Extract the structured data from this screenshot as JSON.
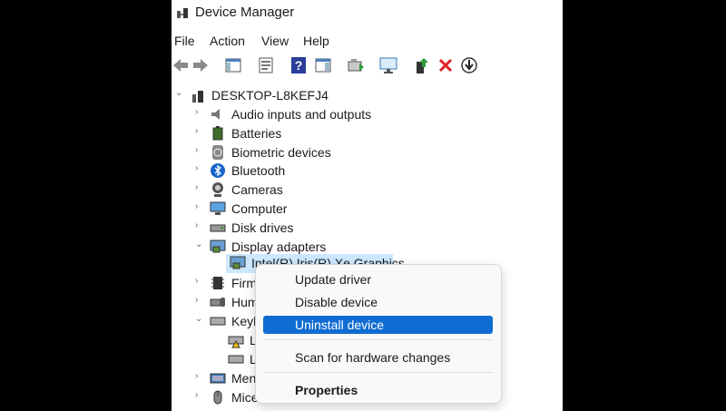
{
  "window": {
    "title": "Device Manager"
  },
  "menu": [
    "File",
    "Action",
    "View",
    "Help"
  ],
  "toolbar": {
    "icons": [
      "back-arrow-icon",
      "forward-arrow-icon",
      "show-hide-console-tree-icon",
      "properties-icon",
      "help-icon",
      "action-pane-icon",
      "update-driver-icon",
      "scan-hardware-icon",
      "enable-device-icon",
      "uninstall-device-icon",
      "disable-device-icon"
    ]
  },
  "tree": {
    "root": "DESKTOP-L8KEFJ4",
    "categories": [
      {
        "label": "Audio inputs and outputs",
        "icon": "speaker-icon"
      },
      {
        "label": "Batteries",
        "icon": "battery-icon"
      },
      {
        "label": "Biometric devices",
        "icon": "fingerprint-icon"
      },
      {
        "label": "Bluetooth",
        "icon": "bluetooth-icon"
      },
      {
        "label": "Cameras",
        "icon": "camera-icon"
      },
      {
        "label": "Computer",
        "icon": "computer-icon"
      },
      {
        "label": "Disk drives",
        "icon": "disk-drive-icon"
      },
      {
        "label": "Display adapters",
        "icon": "display-adapter-icon"
      }
    ],
    "display_child": "Intel(R) Iris(R) Xe Graphics",
    "after": [
      {
        "label": "Firm",
        "icon": "firmware-icon"
      },
      {
        "label": "Hum",
        "icon": "hid-icon"
      },
      {
        "label": "Keyb",
        "icon": "keyboard-icon"
      },
      {
        "label": "L",
        "icon": "warning-keyboard-icon"
      },
      {
        "label": "L",
        "icon": "keyboard-device-icon"
      },
      {
        "label": "Men",
        "icon": "memory-icon"
      },
      {
        "label": "Mice",
        "icon": "mouse-icon"
      }
    ]
  },
  "context_menu": {
    "update": "Update driver",
    "disable": "Disable device",
    "uninstall": "Uninstall device",
    "scan": "Scan for hardware changes",
    "properties": "Properties"
  },
  "colors": {
    "selection": "#cce8ff",
    "menu_highlight": "#0f6cd2"
  }
}
